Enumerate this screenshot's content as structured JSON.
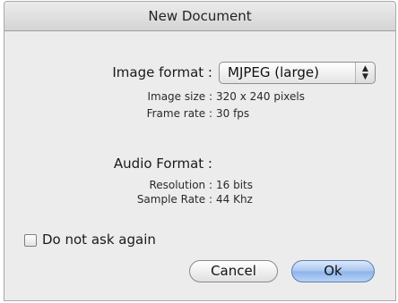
{
  "dialog": {
    "title": "New Document"
  },
  "image": {
    "format_label": "Image format :",
    "format_value": "MJPEG (large)",
    "size_label": "Image size :",
    "size_value": "320 x 240 pixels",
    "rate_label": "Frame rate :",
    "rate_value": "30 fps"
  },
  "audio": {
    "format_label": "Audio Format :",
    "resolution_label": "Resolution :",
    "resolution_value": "16 bits",
    "sample_rate_label": "Sample Rate :",
    "sample_rate_value": "44 Khz"
  },
  "options": {
    "do_not_ask_label": "Do not ask again",
    "do_not_ask_checked": false
  },
  "buttons": {
    "cancel_label": "Cancel",
    "ok_label": "Ok"
  }
}
